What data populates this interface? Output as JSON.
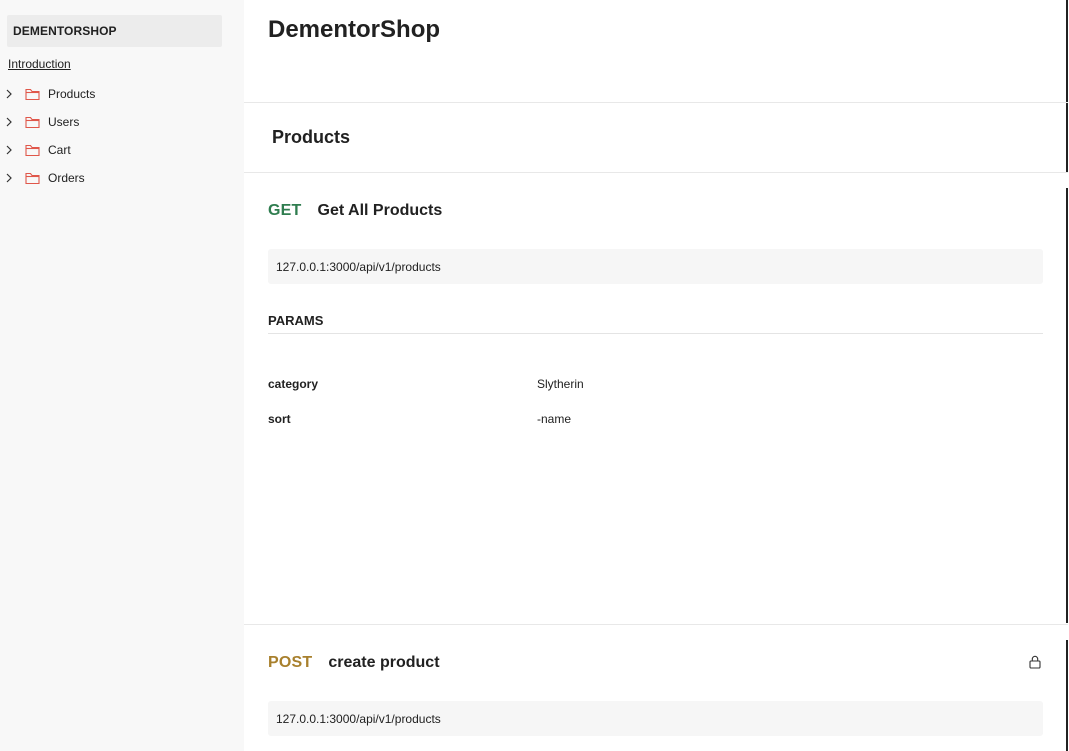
{
  "sidebar": {
    "brand": "DEMENTORSHOP",
    "intro": "Introduction",
    "items": [
      {
        "label": "Products",
        "icon": "folder-icon"
      },
      {
        "label": "Users",
        "icon": "folder-icon"
      },
      {
        "label": "Cart",
        "icon": "folder-icon"
      },
      {
        "label": "Orders",
        "icon": "folder-icon"
      }
    ]
  },
  "main": {
    "title": "DementorShop",
    "section": "Products",
    "requests": [
      {
        "method": "GET",
        "name": "Get All Products",
        "url": "127.0.0.1:3000/api/v1/products",
        "params_title": "PARAMS",
        "params": [
          {
            "key": "category",
            "value": "Slytherin"
          },
          {
            "key": "sort",
            "value": "-name"
          }
        ]
      },
      {
        "method": "POST",
        "name": "create product",
        "url": "127.0.0.1:3000/api/v1/products",
        "icon": "lock-icon"
      }
    ]
  },
  "colors": {
    "get": "#2f7d4f",
    "post": "#a8802d",
    "folder": "#e0574a",
    "sidebar_bg": "#f8f8f8"
  }
}
